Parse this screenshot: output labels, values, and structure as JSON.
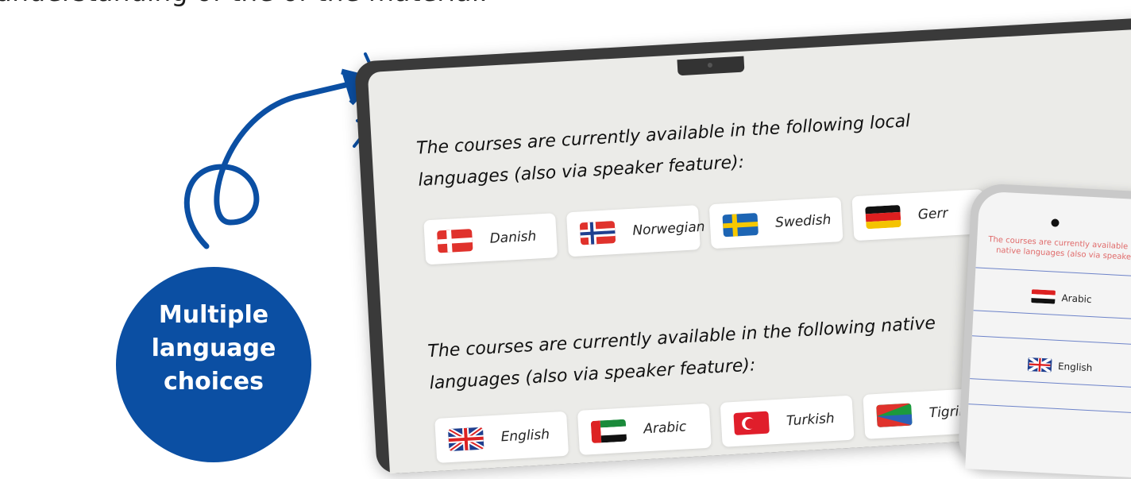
{
  "intro_text": "understanding of the of the material.",
  "badge": {
    "line1": "Multiple",
    "line2": "language",
    "line3": "choices"
  },
  "laptop": {
    "local_heading_line1": "The courses are currently available in the following local",
    "local_heading_line2": "languages (also via speaker feature):",
    "local_languages": [
      "Danish",
      "Norwegian",
      "Swedish",
      "Gerr"
    ],
    "native_heading_line1": "The courses are currently available in the following native",
    "native_heading_line2": "languages (also via speaker feature):",
    "native_languages": [
      "English",
      "Arabic",
      "Turkish",
      "Tigrinya"
    ]
  },
  "phone": {
    "heading_line1": "The courses are currently available in th",
    "heading_line2": "native languages (also via speaker f",
    "items": [
      "Arabic",
      "English"
    ]
  },
  "colors": {
    "badge": "#0b4fa3",
    "arrow": "#0b4fa3",
    "phone_heading": "#e06b6b"
  }
}
